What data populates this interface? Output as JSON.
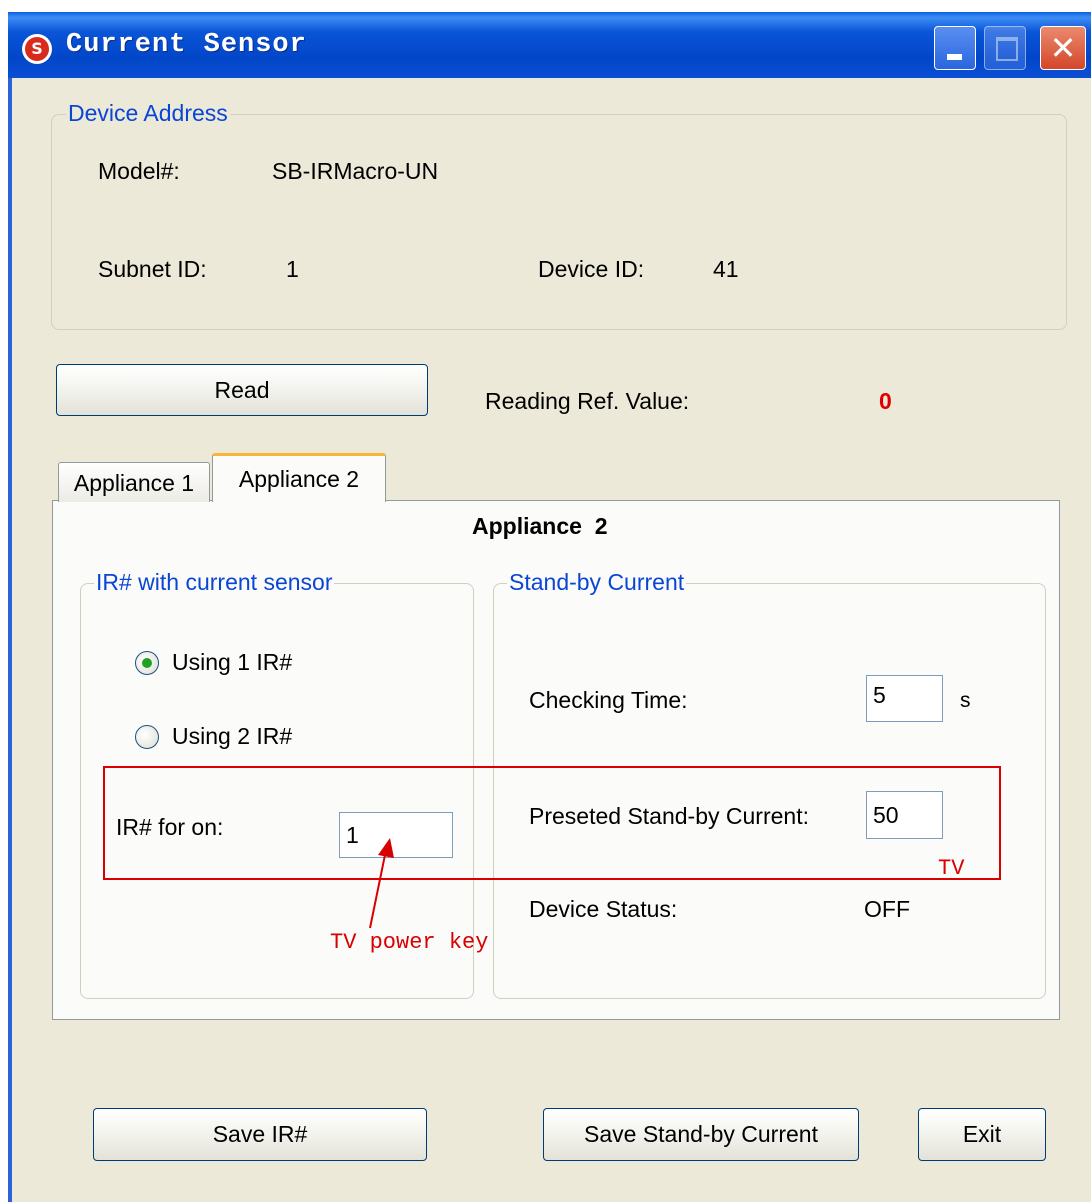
{
  "window": {
    "title": "Current Sensor",
    "app_icon_letter": "S",
    "close_glyph": "✕"
  },
  "device_address": {
    "legend": "Device Address",
    "model_label": "Model#:",
    "model_value": "SB-IRMacro-UN",
    "subnet_label": "Subnet ID:",
    "subnet_value": "1",
    "device_label": "Device ID:",
    "device_value": "41"
  },
  "read_button": "Read",
  "reading_ref": {
    "label": "Reading Ref. Value:",
    "value": "0",
    "value_color": "#e00000"
  },
  "tabs": [
    {
      "label": "Appliance 1"
    },
    {
      "label": "Appliance  2"
    }
  ],
  "tab_page": {
    "heading": "Appliance  2",
    "ir_group": {
      "legend": "IR# with current sensor",
      "radio1": "Using 1 IR#",
      "radio2": "Using 2 IR#",
      "selected": "Using 1 IR#",
      "ir_on_label": "IR# for on:",
      "ir_on_value": "1"
    },
    "standby_group": {
      "legend": "Stand-by Current",
      "checking_label": "Checking Time:",
      "checking_value": "5",
      "checking_unit": "s",
      "preset_label": "Preseted Stand-by Current:",
      "preset_value": "50",
      "status_label": "Device Status:",
      "status_value": "OFF"
    }
  },
  "annotations": {
    "tv_power_key": "TV power key",
    "tv": "TV",
    "color": "#d80000"
  },
  "footer": {
    "save_ir": "Save IR#",
    "save_standby": "Save Stand-by Current",
    "exit": "Exit"
  }
}
